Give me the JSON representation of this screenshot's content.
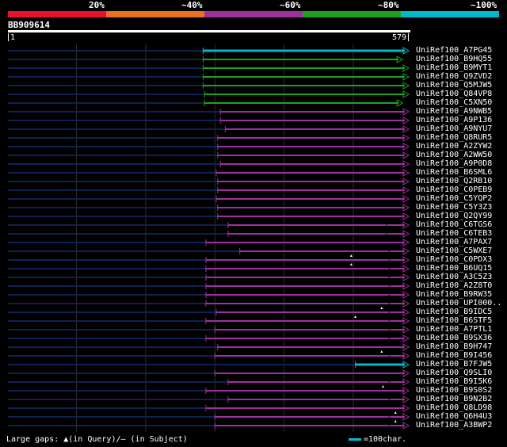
{
  "colors": {
    "background": "#000000",
    "identity_20": "#e8102a",
    "identity_40": "#e87020",
    "identity_60": "#a030a0",
    "identity_80": "#20a020",
    "identity_100": "#00b8c8",
    "unaligned": "#102050",
    "gridline": "#283038",
    "gap_marker": "#ffffff"
  },
  "legend": [
    {
      "label": "20%",
      "color": "#e8102a"
    },
    {
      "label": "~40%",
      "color": "#e87020"
    },
    {
      "label": "~60%",
      "color": "#a030a0"
    },
    {
      "label": "~80%",
      "color": "#20a020"
    },
    {
      "label": "~100%",
      "color": "#00b8c8"
    }
  ],
  "query": {
    "id": "BB909614",
    "start": "1",
    "end": "579",
    "length": 579
  },
  "hits": [
    {
      "label": "UniRef100_A7PG45",
      "start": 283,
      "end": 579,
      "identity": 100,
      "gaps_q": [],
      "gaps_s": []
    },
    {
      "label": "UniRef100_B9HQ55",
      "start": 283,
      "end": 570,
      "identity": 80,
      "gaps_q": [],
      "gaps_s": []
    },
    {
      "label": "UniRef100_B9MYT1",
      "start": 283,
      "end": 579,
      "identity": 80,
      "gaps_q": [],
      "gaps_s": []
    },
    {
      "label": "UniRef100_Q9ZVD2",
      "start": 283,
      "end": 579,
      "identity": 80,
      "gaps_q": [],
      "gaps_s": []
    },
    {
      "label": "UniRef100_Q5MJW5",
      "start": 283,
      "end": 579,
      "identity": 80,
      "gaps_q": [],
      "gaps_s": []
    },
    {
      "label": "UniRef100_Q84VP8",
      "start": 285,
      "end": 579,
      "identity": 80,
      "gaps_q": [],
      "gaps_s": []
    },
    {
      "label": "UniRef100_C5XN50",
      "start": 285,
      "end": 570,
      "identity": 80,
      "gaps_q": [],
      "gaps_s": []
    },
    {
      "label": "UniRef100_A9NWB5",
      "start": 308,
      "end": 579,
      "identity": 60,
      "gaps_q": [],
      "gaps_s": []
    },
    {
      "label": "UniRef100_A9P136",
      "start": 308,
      "end": 579,
      "identity": 60,
      "gaps_q": [],
      "gaps_s": []
    },
    {
      "label": "UniRef100_A9NYU7",
      "start": 315,
      "end": 579,
      "identity": 60,
      "gaps_q": [],
      "gaps_s": []
    },
    {
      "label": "UniRef100_Q8RUR5",
      "start": 304,
      "end": 579,
      "identity": 60,
      "gaps_q": [],
      "gaps_s": []
    },
    {
      "label": "UniRef100_A2ZYW2",
      "start": 304,
      "end": 579,
      "identity": 60,
      "gaps_q": [],
      "gaps_s": []
    },
    {
      "label": "UniRef100_A2WW50",
      "start": 304,
      "end": 579,
      "identity": 60,
      "gaps_q": [],
      "gaps_s": []
    },
    {
      "label": "UniRef100_A9P0D8",
      "start": 308,
      "end": 579,
      "identity": 60,
      "gaps_q": [],
      "gaps_s": []
    },
    {
      "label": "UniRef100_B6SML6",
      "start": 302,
      "end": 579,
      "identity": 60,
      "gaps_q": [],
      "gaps_s": []
    },
    {
      "label": "UniRef100_Q2RB10",
      "start": 304,
      "end": 579,
      "identity": 60,
      "gaps_q": [],
      "gaps_s": []
    },
    {
      "label": "UniRef100_C0PEB9",
      "start": 304,
      "end": 579,
      "identity": 60,
      "gaps_q": [],
      "gaps_s": []
    },
    {
      "label": "UniRef100_C5YQP2",
      "start": 302,
      "end": 579,
      "identity": 60,
      "gaps_q": [],
      "gaps_s": []
    },
    {
      "label": "UniRef100_C5Y3Z3",
      "start": 304,
      "end": 579,
      "identity": 60,
      "gaps_q": [],
      "gaps_s": []
    },
    {
      "label": "UniRef100_Q2QY99",
      "start": 304,
      "end": 579,
      "identity": 60,
      "gaps_q": [],
      "gaps_s": []
    },
    {
      "label": "UniRef100_C6TGS6",
      "start": 319,
      "end": 579,
      "identity": 60,
      "gaps_q": [],
      "gaps_s": [
        548
      ]
    },
    {
      "label": "UniRef100_C6TEB3",
      "start": 319,
      "end": 579,
      "identity": 60,
      "gaps_q": [],
      "gaps_s": [
        548
      ]
    },
    {
      "label": "UniRef100_A7PAX7",
      "start": 287,
      "end": 579,
      "identity": 60,
      "gaps_q": [],
      "gaps_s": []
    },
    {
      "label": "UniRef100_C5WXE7",
      "start": 336,
      "end": 579,
      "identity": 60,
      "gaps_q": [],
      "gaps_s": [
        552
      ]
    },
    {
      "label": "UniRef100_C0PDX3",
      "start": 287,
      "end": 579,
      "identity": 60,
      "gaps_q": [
        497
      ],
      "gaps_s": [
        552
      ]
    },
    {
      "label": "UniRef100_B6UQ15",
      "start": 287,
      "end": 579,
      "identity": 60,
      "gaps_q": [
        497
      ],
      "gaps_s": [
        552
      ]
    },
    {
      "label": "UniRef100_A3C5Z3",
      "start": 287,
      "end": 579,
      "identity": 60,
      "gaps_q": [],
      "gaps_s": [
        552
      ]
    },
    {
      "label": "UniRef100_A2Z8T0",
      "start": 287,
      "end": 579,
      "identity": 60,
      "gaps_q": [],
      "gaps_s": [
        552
      ]
    },
    {
      "label": "UniRef100_B9RW35",
      "start": 287,
      "end": 579,
      "identity": 60,
      "gaps_q": [],
      "gaps_s": [
        552
      ]
    },
    {
      "label": "UniRef100_UPI000..",
      "start": 287,
      "end": 579,
      "identity": 60,
      "gaps_q": [],
      "gaps_s": [
        552
      ]
    },
    {
      "label": "UniRef100_B9IDC5",
      "start": 302,
      "end": 579,
      "identity": 60,
      "gaps_q": [
        541
      ],
      "gaps_s": [
        552
      ]
    },
    {
      "label": "UniRef100_B6STF5",
      "start": 287,
      "end": 579,
      "identity": 60,
      "gaps_q": [
        503
      ],
      "gaps_s": [
        552
      ]
    },
    {
      "label": "UniRef100_A7PTL1",
      "start": 300,
      "end": 579,
      "identity": 60,
      "gaps_q": [],
      "gaps_s": [
        552
      ]
    },
    {
      "label": "UniRef100_B9SX36",
      "start": 287,
      "end": 579,
      "identity": 60,
      "gaps_q": [],
      "gaps_s": [
        552
      ]
    },
    {
      "label": "UniRef100_B9H747",
      "start": 304,
      "end": 579,
      "identity": 60,
      "gaps_q": [],
      "gaps_s": []
    },
    {
      "label": "UniRef100_B9I456",
      "start": 300,
      "end": 579,
      "identity": 60,
      "gaps_q": [
        541
      ],
      "gaps_s": [
        552
      ]
    },
    {
      "label": "UniRef100_B7FJW5",
      "start": 503,
      "end": 579,
      "identity": 100,
      "gaps_q": [],
      "gaps_s": []
    },
    {
      "label": "UniRef100_Q9SLI0",
      "start": 300,
      "end": 579,
      "identity": 60,
      "gaps_q": [],
      "gaps_s": []
    },
    {
      "label": "UniRef100_B9I5K6",
      "start": 319,
      "end": 579,
      "identity": 60,
      "gaps_q": [],
      "gaps_s": [
        552
      ]
    },
    {
      "label": "UniRef100_B9S0S2",
      "start": 287,
      "end": 579,
      "identity": 60,
      "gaps_q": [
        543
      ],
      "gaps_s": []
    },
    {
      "label": "UniRef100_B9N2B2",
      "start": 319,
      "end": 579,
      "identity": 60,
      "gaps_q": [],
      "gaps_s": [
        552
      ]
    },
    {
      "label": "UniRef100_Q8LD98",
      "start": 287,
      "end": 579,
      "identity": 60,
      "gaps_q": [],
      "gaps_s": []
    },
    {
      "label": "UniRef100_Q6H4U3",
      "start": 300,
      "end": 579,
      "identity": 60,
      "gaps_q": [
        561
      ],
      "gaps_s": [
        552
      ]
    },
    {
      "label": "UniRef100_A3BWP2",
      "start": 300,
      "end": 579,
      "identity": 60,
      "gaps_q": [
        561
      ],
      "gaps_s": [
        552
      ]
    }
  ],
  "footer": {
    "gaps_text": "Large gaps: ▲(in Query)/– (in Subject)",
    "scale_text": "=100char."
  }
}
